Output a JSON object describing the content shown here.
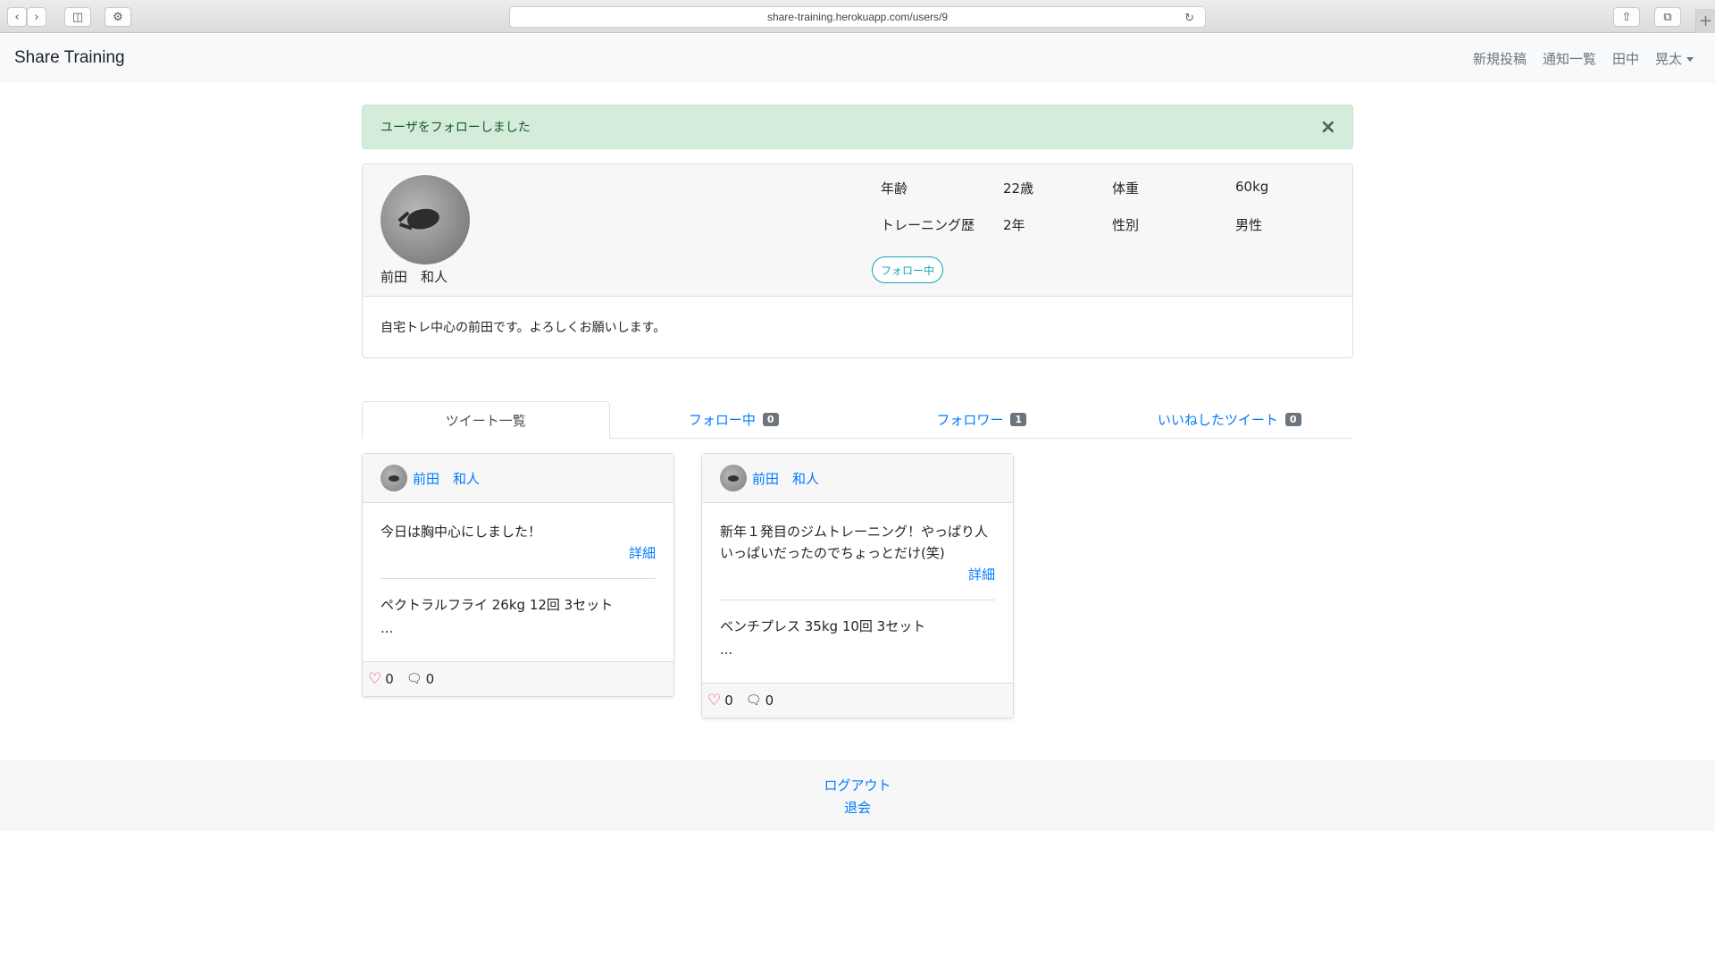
{
  "browser": {
    "url": "share-training.herokuapp.com/users/9"
  },
  "navbar": {
    "brand": "Share Training",
    "links": [
      "新規投稿",
      "通知一覧",
      "田中",
      "晃太"
    ]
  },
  "alert": {
    "message": "ユーザをフォローしました",
    "close": "×"
  },
  "profile": {
    "name": "前田　和人",
    "stats": [
      {
        "label": "年齢",
        "value": "22歳"
      },
      {
        "label": "体重",
        "value": "60kg"
      },
      {
        "label": "トレーニング歴",
        "value": "2年"
      },
      {
        "label": "性別",
        "value": "男性"
      }
    ],
    "follow_button": "フォロー中",
    "bio": "自宅トレ中心の前田です。よろしくお願いします。"
  },
  "tabs": [
    {
      "label": "ツイート一覧",
      "count": null
    },
    {
      "label": "フォロー中",
      "count": "0"
    },
    {
      "label": "フォロワー",
      "count": "1"
    },
    {
      "label": "いいねしたツイート",
      "count": "0"
    }
  ],
  "tweets": [
    {
      "author": "前田　和人",
      "text": "今日は胸中心にしました！",
      "detail": "詳細",
      "menu": "ペクトラルフライ 26kg 12回 3セット",
      "more": "...",
      "likes": "0",
      "comments": "0"
    },
    {
      "author": "前田　和人",
      "text": "新年１発目のジムトレーニング！やっぱり人いっぱいだったのでちょっとだけ(笑)",
      "detail": "詳細",
      "menu": "ベンチプレス 35kg 10回 3セット",
      "more": "...",
      "likes": "0",
      "comments": "0"
    }
  ],
  "footer": {
    "logout": "ログアウト",
    "withdraw": "退会"
  }
}
